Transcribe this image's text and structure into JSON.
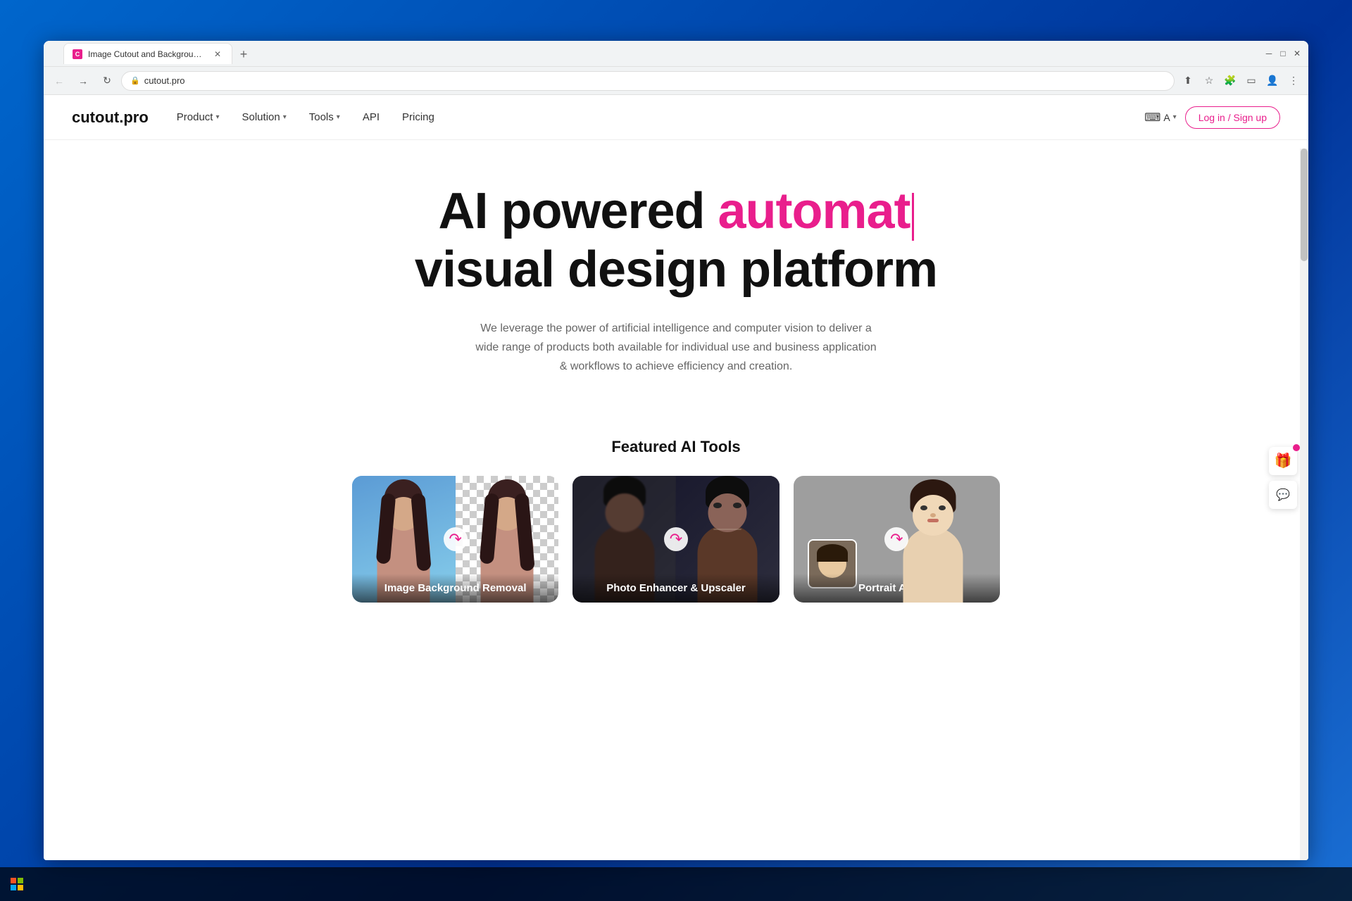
{
  "browser": {
    "tab_title": "Image Cutout and Background R",
    "tab_favicon": "C",
    "address": "cutout.pro",
    "address_display": "cutout.pro"
  },
  "site": {
    "logo": "cutout.pro",
    "nav": {
      "product": "Product",
      "solution": "Solution",
      "tools": "Tools",
      "api": "API",
      "pricing": "Pricing"
    },
    "login_label": "Log in / Sign up",
    "lang_label": "A"
  },
  "hero": {
    "title_static": "AI powered ",
    "title_animated": "automat",
    "title_line2": "visual design platform",
    "subtitle": "We leverage the power of artificial intelligence and computer vision to deliver a wide range of products both available for individual use and business application & workflows to achieve efficiency and creation."
  },
  "featured": {
    "section_title": "Featured AI Tools",
    "tools": [
      {
        "label": "Image Background Removal",
        "id": "bg-removal"
      },
      {
        "label": "Photo Enhancer & Upscaler",
        "id": "photo-enhancer"
      },
      {
        "label": "Portrait Animer",
        "id": "portrait-animer"
      }
    ]
  }
}
